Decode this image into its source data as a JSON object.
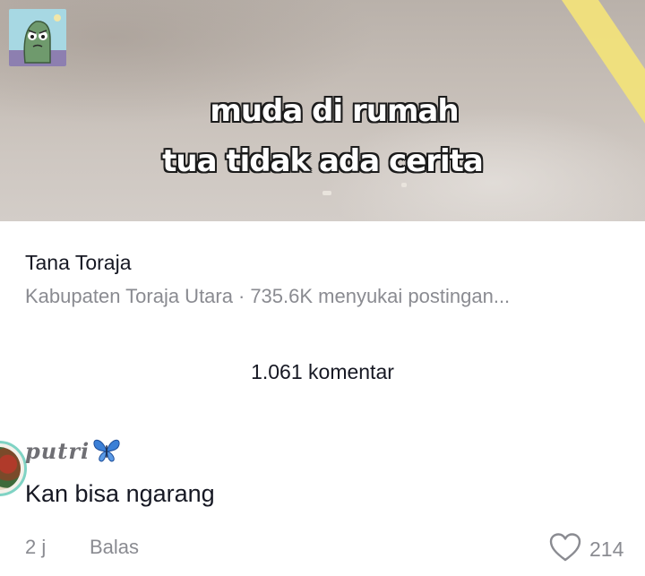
{
  "video": {
    "caption_line1": "muda di rumah",
    "caption_line2": "tua tidak ada cerita",
    "stripe_color": "#f1e27b"
  },
  "location": {
    "name": "Tana Toraja",
    "region": "Kabupaten Toraja Utara",
    "likes_summary": "735.6K menyukai postingan..."
  },
  "comments_header": {
    "count_label": "1.061 komentar"
  },
  "comment": {
    "username": "putri",
    "username_emoji": "butterfly-icon",
    "text": "Kan bisa ngarang",
    "time": "2 j",
    "reply_label": "Balas",
    "like_count": "214"
  },
  "colors": {
    "primary_text": "#161823",
    "secondary_text": "#8a8b91",
    "avatar_ring": "#7fd3c4",
    "butterfly": "#3b7fd6"
  }
}
